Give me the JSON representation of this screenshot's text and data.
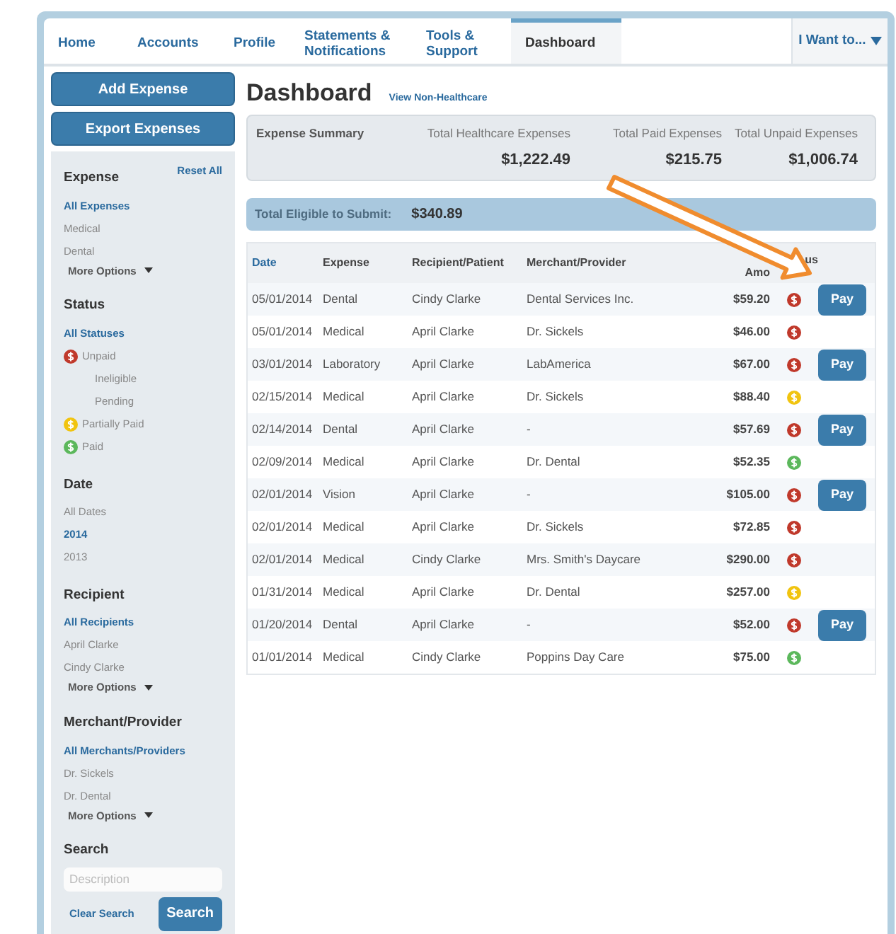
{
  "nav": {
    "tabs": [
      {
        "label": "Home",
        "selected": false
      },
      {
        "label": "Accounts",
        "selected": false
      },
      {
        "label": "Profile",
        "selected": false
      },
      {
        "label": "Statements & Notifications",
        "selected": false
      },
      {
        "label": "Tools & Support",
        "selected": false
      },
      {
        "label": "Dashboard",
        "selected": true
      }
    ],
    "menu": "I Want to..."
  },
  "sidebar": {
    "buttons": [
      "Add Expense",
      "Export Expenses"
    ],
    "reset": "Reset All",
    "filters": [
      {
        "title": "Expense",
        "items": [
          {
            "label": "All Expenses",
            "selected": true
          },
          {
            "label": "Medical",
            "selected": false
          },
          {
            "label": "Dental",
            "selected": false
          }
        ],
        "more": "More Options"
      },
      {
        "title": "Status",
        "items": [
          {
            "label": "All Statuses",
            "selected": true
          },
          {
            "label": "Unpaid",
            "selected": false,
            "color": "#c0392b",
            "children": [
              {
                "label": "Ineligible",
                "selected": false
              },
              {
                "label": "Pending",
                "selected": false
              }
            ]
          },
          {
            "label": "Partially Paid",
            "selected": false,
            "color": "#f1c40f"
          },
          {
            "label": "Paid",
            "selected": false,
            "color": "#5cb85c"
          }
        ]
      },
      {
        "title": "Date",
        "items": [
          {
            "label": "All Dates",
            "selected": false
          },
          {
            "label": "2014",
            "selected": true
          },
          {
            "label": "2013",
            "selected": false
          }
        ]
      },
      {
        "title": "Recipient",
        "items": [
          {
            "label": "All Recipients",
            "selected": true
          },
          {
            "label": "April Clarke",
            "selected": false
          },
          {
            "label": "Cindy Clarke",
            "selected": false
          }
        ],
        "more": "More Options"
      },
      {
        "title": "Merchant/Provider",
        "items": [
          {
            "label": "All Merchants/Providers",
            "selected": true
          },
          {
            "label": "Dr. Sickels",
            "selected": false
          },
          {
            "label": "Dr. Dental",
            "selected": false
          }
        ],
        "more": "More Options"
      }
    ],
    "search": {
      "title": "Search",
      "placeholder": "Description",
      "clear": "Clear Search",
      "button": "Search"
    }
  },
  "main": {
    "title": "Dashboard",
    "link": "View Non-Healthcare",
    "summary": {
      "label": "Expense Summary",
      "totals": [
        {
          "label": "Total Healthcare Expenses",
          "value": "$1,222.49"
        },
        {
          "label": "Total Paid Expenses",
          "value": "$215.75"
        },
        {
          "label": "Total Unpaid Expenses",
          "value": "$1,006.74"
        }
      ]
    },
    "eligible": {
      "label": "Total Eligible to Submit:",
      "value": "$340.89"
    },
    "table": {
      "columns": [
        "Date",
        "Expense",
        "Recipient/Patient",
        "Merchant/Provider",
        "Amo",
        "us"
      ],
      "rows": [
        {
          "date": "05/01/2014",
          "expense": "Dental",
          "recipient": "Cindy Clarke",
          "merchant": "Dental Services Inc.",
          "amount": "$59.20",
          "color": "#c0392b",
          "pay": "Pay"
        },
        {
          "date": "05/01/2014",
          "expense": "Medical",
          "recipient": "April Clarke",
          "merchant": "Dr. Sickels",
          "amount": "$46.00",
          "color": "#c0392b"
        },
        {
          "date": "03/01/2014",
          "expense": "Laboratory",
          "recipient": "April Clarke",
          "merchant": "LabAmerica",
          "amount": "$67.00",
          "color": "#c0392b",
          "pay": "Pay"
        },
        {
          "date": "02/15/2014",
          "expense": "Medical",
          "recipient": "April Clarke",
          "merchant": "Dr. Sickels",
          "amount": "$88.40",
          "color": "#f1c40f"
        },
        {
          "date": "02/14/2014",
          "expense": "Dental",
          "recipient": "April Clarke",
          "merchant": "-",
          "amount": "$57.69",
          "color": "#c0392b",
          "pay": "Pay"
        },
        {
          "date": "02/09/2014",
          "expense": "Medical",
          "recipient": "April Clarke",
          "merchant": "Dr. Dental",
          "amount": "$52.35",
          "color": "#5cb85c"
        },
        {
          "date": "02/01/2014",
          "expense": "Vision",
          "recipient": "April Clarke",
          "merchant": "-",
          "amount": "$105.00",
          "color": "#c0392b",
          "pay": "Pay"
        },
        {
          "date": "02/01/2014",
          "expense": "Medical",
          "recipient": "April Clarke",
          "merchant": "Dr. Sickels",
          "amount": "$72.85",
          "color": "#c0392b"
        },
        {
          "date": "02/01/2014",
          "expense": "Medical",
          "recipient": "Cindy Clarke",
          "merchant": "Mrs. Smith's Daycare",
          "amount": "$290.00",
          "color": "#c0392b"
        },
        {
          "date": "01/31/2014",
          "expense": "Medical",
          "recipient": "April Clarke",
          "merchant": "Dr. Dental",
          "amount": "$257.00",
          "color": "#f1c40f"
        },
        {
          "date": "01/20/2014",
          "expense": "Dental",
          "recipient": "April Clarke",
          "merchant": "-",
          "amount": "$52.00",
          "color": "#c0392b",
          "pay": "Pay"
        },
        {
          "date": "01/01/2014",
          "expense": "Medical",
          "recipient": "Cindy Clarke",
          "merchant": "Poppins Day Care",
          "amount": "$75.00",
          "color": "#5cb85c"
        }
      ]
    }
  }
}
